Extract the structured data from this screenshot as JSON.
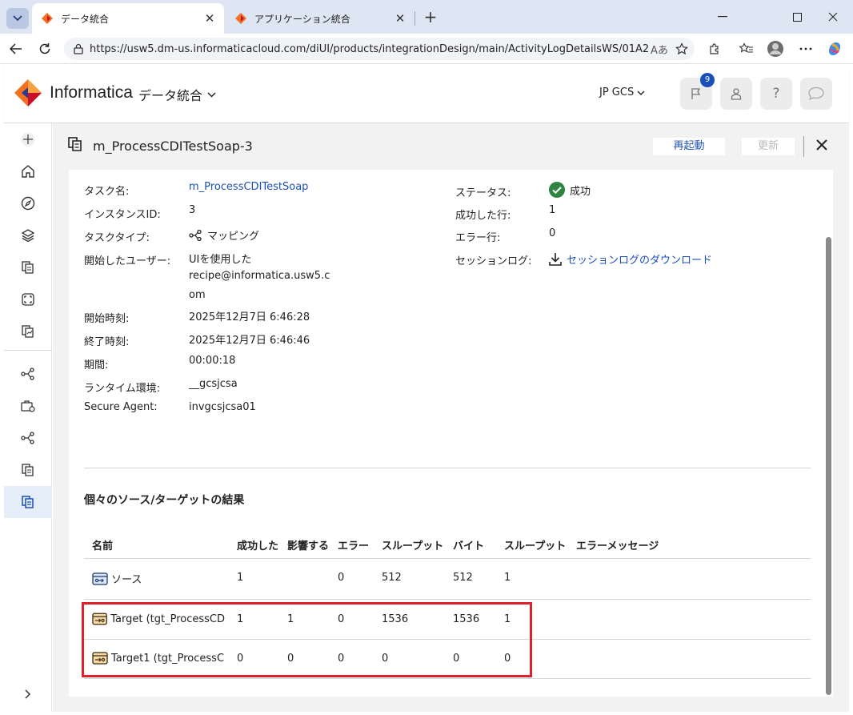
{
  "browser": {
    "tabs": [
      {
        "title": "データ統合",
        "active": true
      },
      {
        "title": "アプリケーション統合",
        "active": false
      }
    ],
    "url": "https://usw5.dm-us.informaticacloud.com/diUI/products/integrationDesign/main/ActivityLogDetailsWS/01A26..."
  },
  "header": {
    "brand": "Informatica",
    "product": "データ統合",
    "org": "JP GCS",
    "notification_count": "9"
  },
  "page": {
    "title": "m_ProcessCDITestSoap-3",
    "restart_label": "再起動",
    "refresh_label": "更新"
  },
  "details_left": [
    {
      "label": "タスク名:",
      "value": "m_ProcessCDITestSoap"
    },
    {
      "label": "インスタンスID:",
      "value": "3"
    },
    {
      "label": "タスクタイプ:",
      "value": "マッピング"
    },
    {
      "label": "開始したユーザー:",
      "value_lines": [
        "UIを使用した",
        "recipe@informatica.usw5.c",
        "om"
      ]
    },
    {
      "label": "開始時刻:",
      "value": "2025年12月7日 6:46:28"
    },
    {
      "label": "終了時刻:",
      "value": "2025年12月7日 6:46:46"
    },
    {
      "label": "期間:",
      "value": "00:00:18"
    },
    {
      "label": "ランタイム環境:",
      "value": "__gcsjcsa"
    },
    {
      "label": "Secure Agent:",
      "value": "invgcsjcsa01"
    }
  ],
  "details_right": [
    {
      "label": "ステータス:",
      "value": "成功",
      "status_color": "#2e8540"
    },
    {
      "label": "成功した行:",
      "value": "1"
    },
    {
      "label": "エラー行:",
      "value": "0"
    },
    {
      "label": "セッションログ:",
      "value": "セッションログのダウンロード"
    }
  ],
  "results": {
    "title": "個々のソース/ターゲットの結果",
    "columns": [
      "名前",
      "成功した",
      "影響する",
      "エラー",
      "スループット",
      "バイト",
      "スループット",
      "エラーメッセージ"
    ],
    "rows": [
      {
        "name": "ソース",
        "icon": "source-icon",
        "cells": [
          "1",
          "",
          "0",
          "512",
          "512",
          "1",
          ""
        ]
      },
      {
        "name": "Target (tgt_ProcessCD",
        "icon": "target-icon",
        "cells": [
          "1",
          "1",
          "0",
          "1536",
          "1536",
          "1",
          ""
        ]
      },
      {
        "name": "Target1 (tgt_ProcessC",
        "icon": "target-icon",
        "cells": [
          "0",
          "0",
          "0",
          "0",
          "0",
          "0",
          ""
        ]
      }
    ]
  },
  "colors": {
    "link": "#1b4fb8",
    "highlight_box": "#e0202a",
    "success": "#2e8540"
  }
}
